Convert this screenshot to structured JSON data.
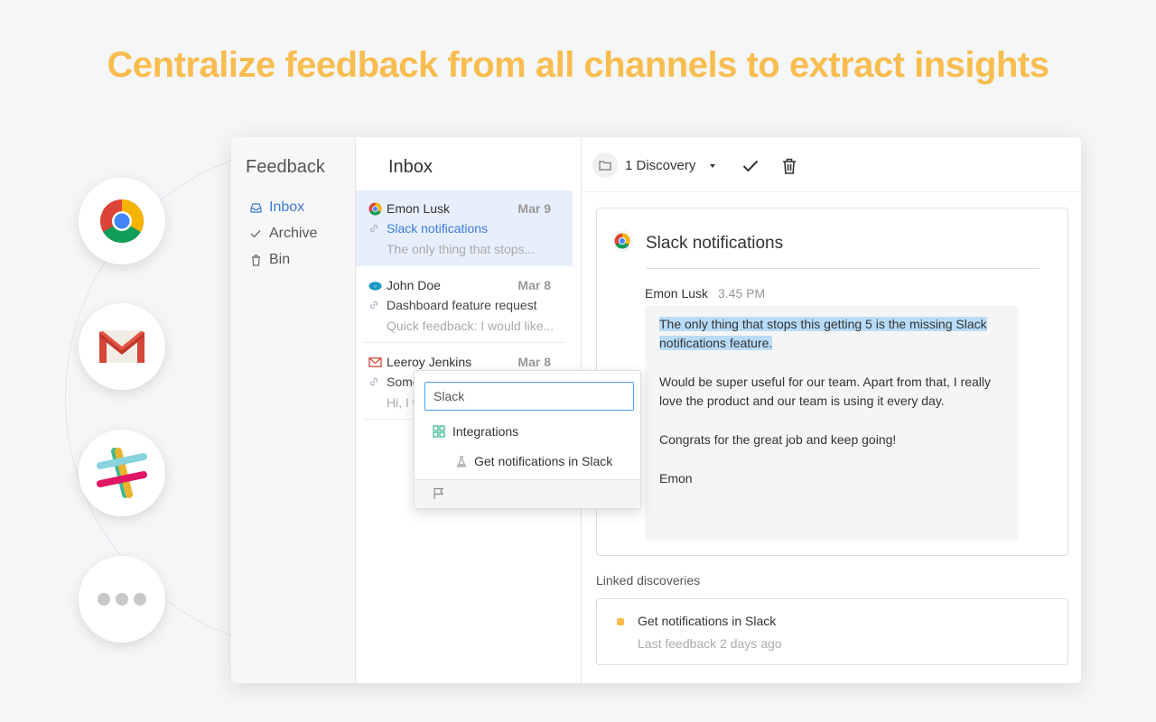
{
  "headline": "Centralize feedback from all channels to extract insights",
  "integrations": [
    "chrome-icon",
    "gmail-icon",
    "slack-icon",
    "more-icon"
  ],
  "sidebar": {
    "title": "Feedback",
    "items": [
      {
        "label": "Inbox",
        "icon": "inbox-icon",
        "active": true
      },
      {
        "label": "Archive",
        "icon": "check-icon"
      },
      {
        "label": "Bin",
        "icon": "trash-icon"
      }
    ]
  },
  "inbox": {
    "title": "Inbox",
    "items": [
      {
        "name": "Emon Lusk",
        "date": "Mar 9",
        "subject": "Slack notifications",
        "preview": "The only thing that stops...",
        "source": "chrome-icon"
      },
      {
        "name": "John Doe",
        "date": "Mar 8",
        "subject": "Dashboard feature request",
        "preview": "Quick feedback: I would like...",
        "source": "salesforce-icon"
      },
      {
        "name": "Leeroy Jenkins",
        "date": "Mar 8",
        "subject": "Some",
        "preview": "Hi, I w",
        "source": "mail-icon"
      }
    ]
  },
  "toolbar": {
    "discovery_label": "1 Discovery"
  },
  "detail": {
    "title": "Slack notifications",
    "author": "Emon Lusk",
    "time": "3.45 PM",
    "highlight": "The only thing that stops this getting 5 is the missing Slack notifications feature.",
    "paragraphs": [
      "Would be super useful for our team. Apart from that, I really love the product and our team is using it every day.",
      "Congrats for the great job and keep going!",
      "Emon"
    ]
  },
  "linked": {
    "label": "Linked discoveries",
    "items": [
      {
        "title": "Get notifications in Slack",
        "subtitle": "Last feedback 2 days ago"
      }
    ]
  },
  "popup": {
    "search_value": "Slack",
    "category": "Integrations",
    "option": "Get notifications in Slack"
  },
  "colors": {
    "accent": "#f8bd4f",
    "link": "#3a7bd5",
    "highlight": "#b8dcf8"
  }
}
